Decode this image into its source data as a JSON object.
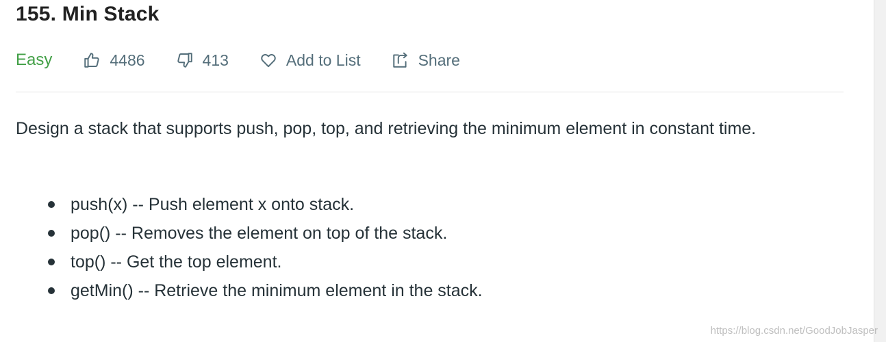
{
  "problem": {
    "title": "155. Min Stack",
    "difficulty": "Easy",
    "likes": "4486",
    "dislikes": "413",
    "add_to_list_label": "Add to List",
    "share_label": "Share"
  },
  "description": {
    "intro": "Design a stack that supports push, pop, top, and retrieving the minimum element in constant time.",
    "operations": [
      "push(x) -- Push element x onto stack.",
      "pop() -- Removes the element on top of the stack.",
      "top() -- Get the top element.",
      "getMin() -- Retrieve the minimum element in the stack."
    ]
  },
  "watermark": "https://blog.csdn.net/GoodJobJasper",
  "colors": {
    "difficulty_easy": "#43a047",
    "meta_text": "#546e7a",
    "body_text": "#263238"
  },
  "icons": {
    "like": "thumbs-up-icon",
    "dislike": "thumbs-down-icon",
    "add_to_list": "heart-icon",
    "share": "share-icon"
  }
}
